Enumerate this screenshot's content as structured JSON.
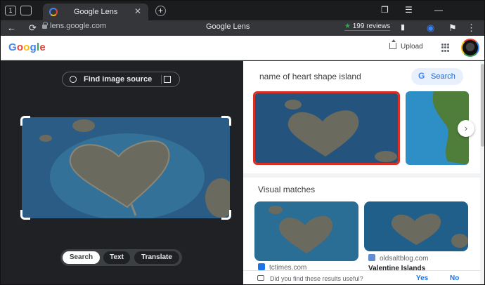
{
  "browser": {
    "tab_count_badge": "1",
    "tab_title": "Google Lens",
    "tab_close": "✕",
    "new_tab": "+",
    "url": "lens.google.com",
    "page_title": "Google Lens",
    "reviews": "199 reviews",
    "reviews_star": "★",
    "back": "←",
    "reload": "⟳",
    "minimize": "—"
  },
  "header": {
    "logo_letters": [
      "G",
      "o",
      "o",
      "g",
      "l",
      "e"
    ],
    "upload_label": "Upload"
  },
  "lens": {
    "find_source_label": "Find image source",
    "modes": [
      "Search",
      "Text",
      "Translate"
    ],
    "active_mode": "Search"
  },
  "results": {
    "query": "name of heart shape island",
    "search_button": "Search",
    "search_button_g": "G",
    "next_arrow": "›",
    "visual_matches_title": "Visual matches",
    "matches": [
      {
        "source": "tctimes.com",
        "title": "",
        "favicon_color": "#1a73e8"
      },
      {
        "source": "oldsaltblog.com",
        "title": "Valentine Islands",
        "favicon_color": "#5f8dd3"
      }
    ],
    "feedback_question": "Did you find these results useful?",
    "feedback_yes": "Yes",
    "feedback_no": "No"
  },
  "colors": {
    "accent": "#1a73e8",
    "selection_border": "#d93025",
    "sea": "#2b5c85",
    "island": "#6b6a5e"
  },
  "icons": {
    "lens_search": "image-search-icon",
    "open_external": "open-external-icon",
    "apps": "apps-grid-icon",
    "upload": "upload-icon",
    "feedback": "feedback-icon"
  }
}
